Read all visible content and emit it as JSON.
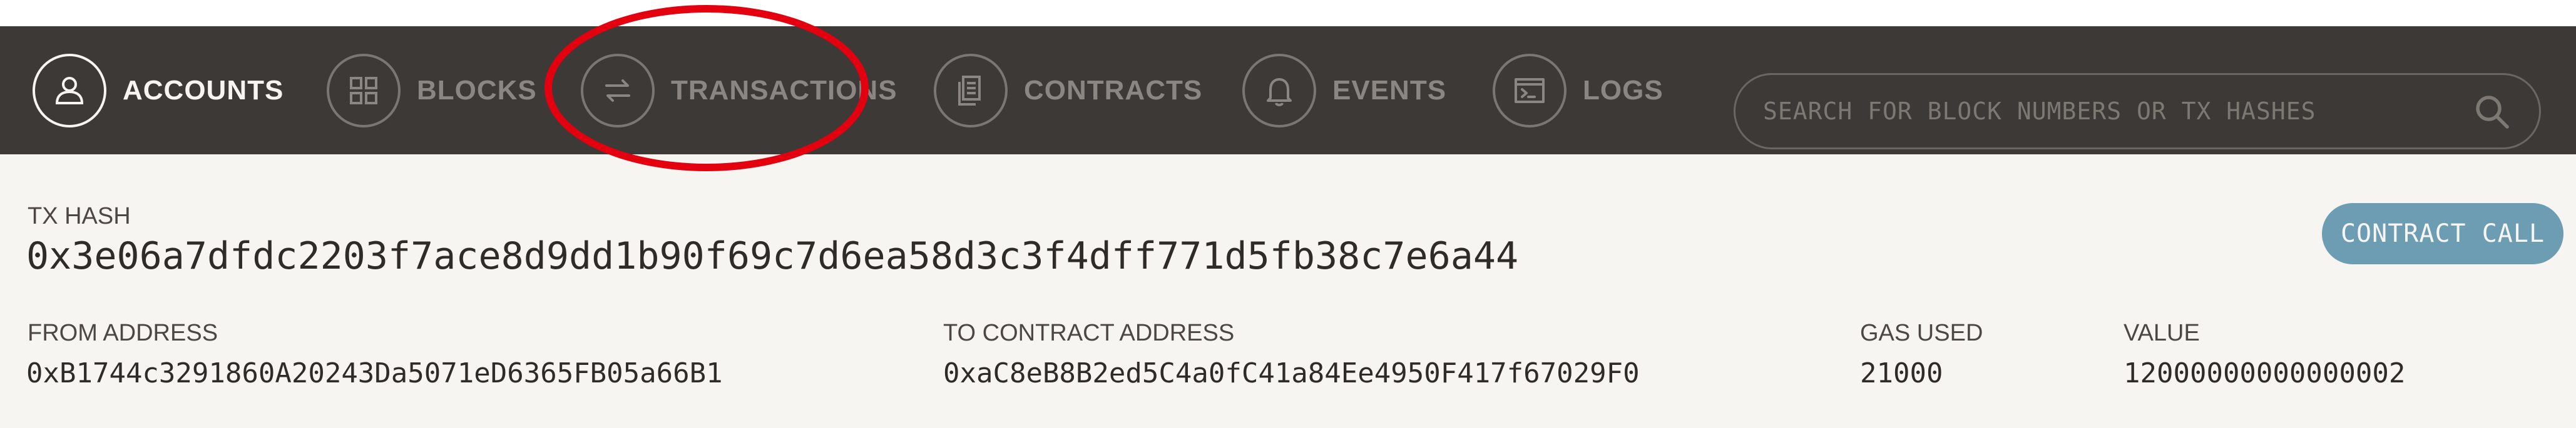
{
  "nav": {
    "items": [
      {
        "label": "ACCOUNTS",
        "icon": "account-icon",
        "active": true
      },
      {
        "label": "BLOCKS",
        "icon": "blocks-icon",
        "active": false
      },
      {
        "label": "TRANSACTIONS",
        "icon": "transactions-icon",
        "active": false,
        "highlighted": true
      },
      {
        "label": "CONTRACTS",
        "icon": "contracts-icon",
        "active": false
      },
      {
        "label": "EVENTS",
        "icon": "bell-icon",
        "active": false
      },
      {
        "label": "LOGS",
        "icon": "logs-icon",
        "active": false
      }
    ],
    "search": {
      "placeholder": "SEARCH FOR BLOCK NUMBERS OR TX HASHES",
      "value": "",
      "icon": "search-icon"
    }
  },
  "tx": {
    "hash_label": "TX HASH",
    "hash": "0x3e06a7dfdc2203f7ace8d9dd1b90f69c7d6ea58d3c3f4dff771d5fb38c7e6a44",
    "badge": "CONTRACT CALL",
    "from_label": "FROM ADDRESS",
    "from": "0xB1744c3291860A20243Da5071eD6365FB05a66B1",
    "to_label": "TO CONTRACT ADDRESS",
    "to": "0xaC8eB8B2ed5C4a0fC41a84Ee4950F417f67029F0",
    "gas_label": "GAS USED",
    "gas": "21000",
    "value_label": "VALUE",
    "value": "12000000000000002"
  },
  "colors": {
    "nav_bg": "#3d3937",
    "page_bg": "#f7f5f1",
    "badge_bg": "#6c9db3",
    "highlight": "#e3000f",
    "inactive": "#8b8682"
  }
}
